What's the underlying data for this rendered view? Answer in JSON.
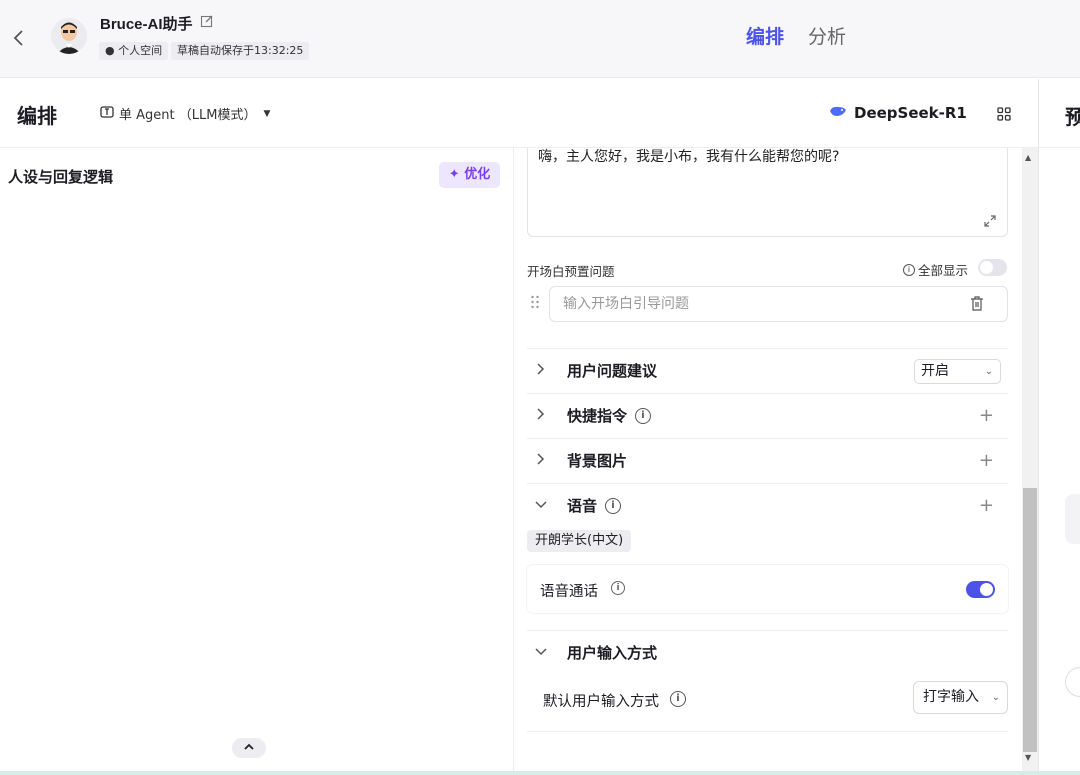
{
  "header": {
    "back_icon": "chevron-left-icon",
    "bot_name": "Bruce-AI助手",
    "space_badge": "个人空间",
    "save_status": "草稿自动保存于13:32:25",
    "tabs": [
      {
        "label": "编排",
        "active": true
      },
      {
        "label": "分析",
        "active": false
      }
    ],
    "accent_color": "#4d53e8"
  },
  "toolbar": {
    "section_title": "编排",
    "agent_mode": "单 Agent （LLM模式）",
    "model_name": "DeepSeek-R1",
    "preview_title": "预"
  },
  "left_pane": {
    "title": "人设与回复逻辑",
    "optimize_label": "优化"
  },
  "middle_pane": {
    "greeting": "嗨，主人您好，我是小布，我有什么能帮您的呢?",
    "preset_questions_label": "开场白预置问题",
    "show_all_label": "全部显示",
    "question_placeholder": "输入开场白引导问题",
    "sections": [
      {
        "label": "用户问题建议",
        "control": "开启",
        "expanded": false
      },
      {
        "label": "快捷指令",
        "expanded": false
      },
      {
        "label": "背景图片",
        "expanded": false
      },
      {
        "label": "语音",
        "expanded": true
      }
    ],
    "voice_chip": "开朗学长(中文)",
    "voice_call_label": "语音通话",
    "voice_call_enabled": true,
    "input_section_label": "用户输入方式",
    "default_input_label": "默认用户输入方式",
    "default_input_value": "打字输入"
  }
}
